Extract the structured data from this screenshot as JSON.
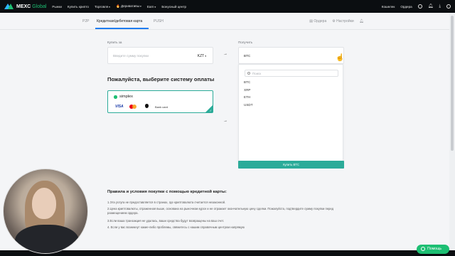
{
  "header": {
    "logo_main": "MEXC",
    "logo_sub": "Global",
    "nav": [
      {
        "label": "Рынки",
        "caret": false
      },
      {
        "label": "Купить крипто",
        "caret": false
      },
      {
        "label": "Торговля",
        "caret": true
      },
      {
        "label": "Деривативы",
        "caret": true,
        "prefix": "🔥"
      },
      {
        "label": "Earn",
        "caret": true
      },
      {
        "label": "Бонусный центр",
        "caret": false
      }
    ],
    "right": {
      "wallet": "Кошелек",
      "orders": "Ордера"
    }
  },
  "subnav": {
    "tabs": [
      {
        "label": "P2P",
        "active": false
      },
      {
        "label": "Кредитная/дебетовая карта",
        "active": true
      },
      {
        "label": "PUSH",
        "active": false
      }
    ],
    "orders_link": "Ордера",
    "settings_link": "Настройки"
  },
  "form": {
    "spend_label": "Купить за",
    "spend_placeholder": "Введите сумму покупки",
    "spend_currency": "KZT",
    "receive_label": "Получить",
    "receive_currency": "BTC",
    "dropdown": {
      "search_placeholder": "Поиск",
      "options": [
        "BTC",
        "XRP",
        "ETH",
        "USDT"
      ]
    },
    "buy_button": "Купить BTC"
  },
  "payment": {
    "title": "Пожалуйста, выберите систему оплаты",
    "provider": "simplex",
    "methods": {
      "visa": "VISA",
      "bank": "Bank card"
    }
  },
  "terms": {
    "title": "Правила и условия покупки с помощью кредитной карты:",
    "items": [
      "1.Эта услуга не предоставляется в странах, где криптовалюта считается незаконной.",
      "2.Цена криптовалюты, отраженная выше, основана на рыночном курсе и не отражает окончательную цену сделки. Пожалуйста, подтвердите сумму покупки перед размещением ордера.",
      "3.Если ваша транзакция не удалась, ваши средства будут возвращены на ваш счет.",
      "4. Если у вас возникнут какие-либо проблемы, свяжитесь с нашим справочным центром напрямую"
    ]
  },
  "help_button": "Помощь",
  "colors": {
    "accent": "#2bab99",
    "brand_green": "#1dbf73",
    "topbar": "#0b0e11",
    "tab_active": "#1f7df0"
  }
}
